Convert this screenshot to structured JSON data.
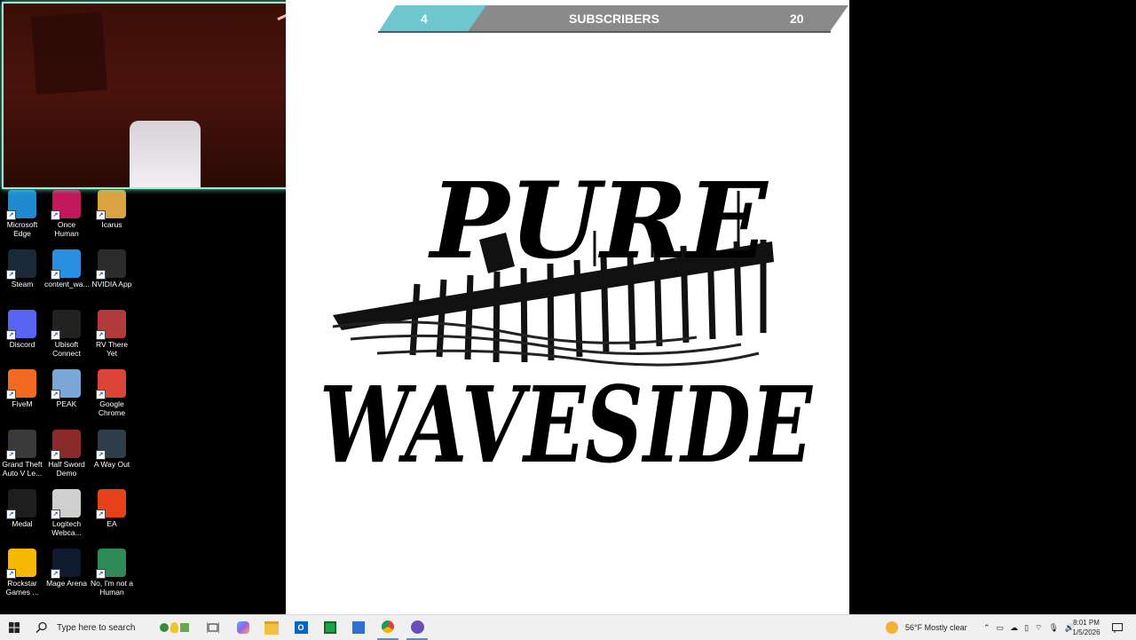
{
  "subscriber_bar": {
    "current": "4",
    "label": "SUBSCRIBERS",
    "goal": "20"
  },
  "logo": {
    "line1": "PURE",
    "line2": "WAVESIDE"
  },
  "desktop_icons": [
    {
      "label": "Microsoft Edge",
      "icon": "edge-icon",
      "color": "#1f8ad0"
    },
    {
      "label": "Once Human",
      "icon": "once-human-icon",
      "color": "#c2185b"
    },
    {
      "label": "Icarus",
      "icon": "icarus-icon",
      "color": "#d9a441"
    },
    {
      "label": "Steam",
      "icon": "steam-icon",
      "color": "#1b2838"
    },
    {
      "label": "content_wa...",
      "icon": "content-wallpaper-icon",
      "color": "#2a8fe0"
    },
    {
      "label": "NVIDIA App",
      "icon": "nvidia-icon",
      "color": "#2b2b2b"
    },
    {
      "label": "Discord",
      "icon": "discord-icon",
      "color": "#5865f2"
    },
    {
      "label": "Ubisoft Connect",
      "icon": "ubisoft-icon",
      "color": "#222222"
    },
    {
      "label": "RV There Yet",
      "icon": "rv-there-yet-icon",
      "color": "#b23a3a"
    },
    {
      "label": "FiveM",
      "icon": "fivem-icon",
      "color": "#f26a22"
    },
    {
      "label": "PEAK",
      "icon": "peak-icon",
      "color": "#7aa7d8"
    },
    {
      "label": "Google Chrome",
      "icon": "chrome-icon",
      "color": "#db4437"
    },
    {
      "label": "Grand Theft Auto V Le...",
      "icon": "gta-v-icon",
      "color": "#3a3a3a"
    },
    {
      "label": "Half Sword Demo",
      "icon": "half-sword-icon",
      "color": "#8a2a2a"
    },
    {
      "label": "A Way Out",
      "icon": "a-way-out-icon",
      "color": "#2f3d4a"
    },
    {
      "label": "Medal",
      "icon": "medal-icon",
      "color": "#1e1e1e"
    },
    {
      "label": "Logitech Webca...",
      "icon": "logitech-webcam-icon",
      "color": "#cfcfcf"
    },
    {
      "label": "EA",
      "icon": "ea-icon",
      "color": "#e5421b"
    },
    {
      "label": "Rockstar Games ...",
      "icon": "rockstar-icon",
      "color": "#f6b800"
    },
    {
      "label": "Mage Arena",
      "icon": "mage-arena-icon",
      "color": "#101a2e"
    },
    {
      "label": "No, I'm not a Human",
      "icon": "no-im-not-human-icon",
      "color": "#2e8b57"
    }
  ],
  "taskbar": {
    "search_placeholder": "Type here to search",
    "weather": "56°F  Mostly clear",
    "time": "8:01 PM",
    "date": "1/5/2026"
  }
}
